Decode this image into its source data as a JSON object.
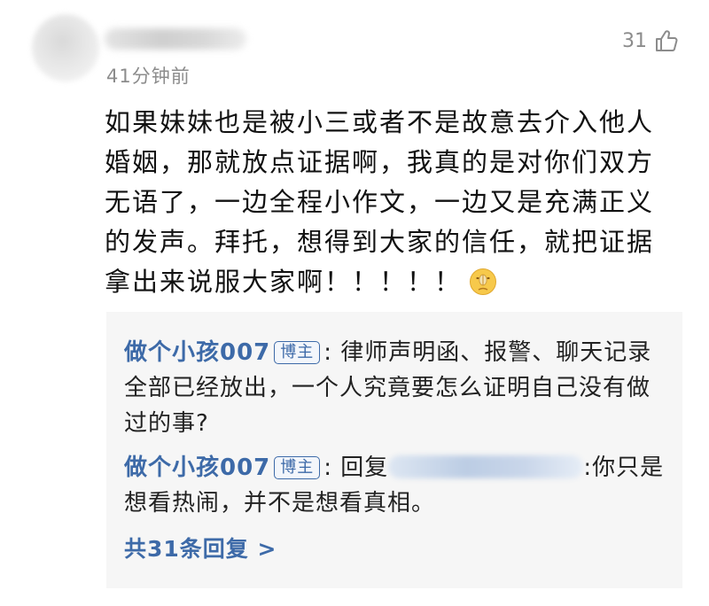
{
  "comment": {
    "timestamp": "41分钟前",
    "like_count": "31",
    "body_lines": [
      "如果妹妹也是被小三或者不是故意去介入他人",
      "婚姻，那就放点证据啊，我真的是对你们双方",
      "无语了，一边全程小作文，一边又是充满正义",
      "的发声。拜托，想得到大家的信任，就把证据",
      "拿出来说服大家啊！！！！！"
    ],
    "icons": {
      "like": "thumbs-up-icon",
      "emoji": "hush-emoji-icon"
    }
  },
  "replies": {
    "items": [
      {
        "author": "做个小孩007",
        "badge": "博主",
        "text": ": 律师声明函、报警、聊天记录全部已经放出，一个人究竟要怎么证明自己没有做过的事?"
      },
      {
        "author": "做个小孩007",
        "badge": "博主",
        "reply_prefix": ": 回复",
        "text": ":你只是想看热闹，并不是想看真相。"
      }
    ],
    "view_all": "共31条回复 >"
  },
  "colors": {
    "link": "#3d6aa8",
    "muted": "#8c8c8c",
    "reply_bg": "#f6f6f6"
  }
}
